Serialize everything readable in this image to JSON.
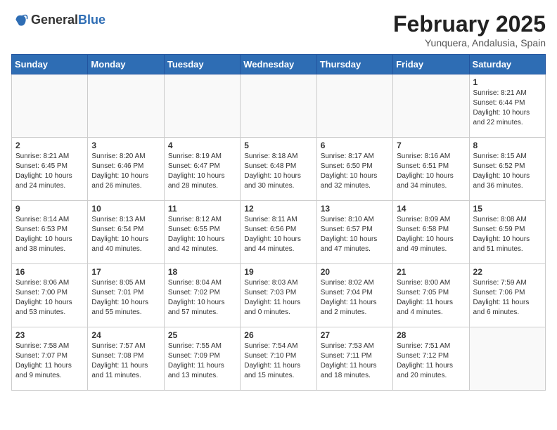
{
  "header": {
    "logo_general": "General",
    "logo_blue": "Blue",
    "month_title": "February 2025",
    "location": "Yunquera, Andalusia, Spain"
  },
  "weekdays": [
    "Sunday",
    "Monday",
    "Tuesday",
    "Wednesday",
    "Thursday",
    "Friday",
    "Saturday"
  ],
  "weeks": [
    [
      {
        "day": "",
        "info": ""
      },
      {
        "day": "",
        "info": ""
      },
      {
        "day": "",
        "info": ""
      },
      {
        "day": "",
        "info": ""
      },
      {
        "day": "",
        "info": ""
      },
      {
        "day": "",
        "info": ""
      },
      {
        "day": "1",
        "info": "Sunrise: 8:21 AM\nSunset: 6:44 PM\nDaylight: 10 hours and 22 minutes."
      }
    ],
    [
      {
        "day": "2",
        "info": "Sunrise: 8:21 AM\nSunset: 6:45 PM\nDaylight: 10 hours and 24 minutes."
      },
      {
        "day": "3",
        "info": "Sunrise: 8:20 AM\nSunset: 6:46 PM\nDaylight: 10 hours and 26 minutes."
      },
      {
        "day": "4",
        "info": "Sunrise: 8:19 AM\nSunset: 6:47 PM\nDaylight: 10 hours and 28 minutes."
      },
      {
        "day": "5",
        "info": "Sunrise: 8:18 AM\nSunset: 6:48 PM\nDaylight: 10 hours and 30 minutes."
      },
      {
        "day": "6",
        "info": "Sunrise: 8:17 AM\nSunset: 6:50 PM\nDaylight: 10 hours and 32 minutes."
      },
      {
        "day": "7",
        "info": "Sunrise: 8:16 AM\nSunset: 6:51 PM\nDaylight: 10 hours and 34 minutes."
      },
      {
        "day": "8",
        "info": "Sunrise: 8:15 AM\nSunset: 6:52 PM\nDaylight: 10 hours and 36 minutes."
      }
    ],
    [
      {
        "day": "9",
        "info": "Sunrise: 8:14 AM\nSunset: 6:53 PM\nDaylight: 10 hours and 38 minutes."
      },
      {
        "day": "10",
        "info": "Sunrise: 8:13 AM\nSunset: 6:54 PM\nDaylight: 10 hours and 40 minutes."
      },
      {
        "day": "11",
        "info": "Sunrise: 8:12 AM\nSunset: 6:55 PM\nDaylight: 10 hours and 42 minutes."
      },
      {
        "day": "12",
        "info": "Sunrise: 8:11 AM\nSunset: 6:56 PM\nDaylight: 10 hours and 44 minutes."
      },
      {
        "day": "13",
        "info": "Sunrise: 8:10 AM\nSunset: 6:57 PM\nDaylight: 10 hours and 47 minutes."
      },
      {
        "day": "14",
        "info": "Sunrise: 8:09 AM\nSunset: 6:58 PM\nDaylight: 10 hours and 49 minutes."
      },
      {
        "day": "15",
        "info": "Sunrise: 8:08 AM\nSunset: 6:59 PM\nDaylight: 10 hours and 51 minutes."
      }
    ],
    [
      {
        "day": "16",
        "info": "Sunrise: 8:06 AM\nSunset: 7:00 PM\nDaylight: 10 hours and 53 minutes."
      },
      {
        "day": "17",
        "info": "Sunrise: 8:05 AM\nSunset: 7:01 PM\nDaylight: 10 hours and 55 minutes."
      },
      {
        "day": "18",
        "info": "Sunrise: 8:04 AM\nSunset: 7:02 PM\nDaylight: 10 hours and 57 minutes."
      },
      {
        "day": "19",
        "info": "Sunrise: 8:03 AM\nSunset: 7:03 PM\nDaylight: 11 hours and 0 minutes."
      },
      {
        "day": "20",
        "info": "Sunrise: 8:02 AM\nSunset: 7:04 PM\nDaylight: 11 hours and 2 minutes."
      },
      {
        "day": "21",
        "info": "Sunrise: 8:00 AM\nSunset: 7:05 PM\nDaylight: 11 hours and 4 minutes."
      },
      {
        "day": "22",
        "info": "Sunrise: 7:59 AM\nSunset: 7:06 PM\nDaylight: 11 hours and 6 minutes."
      }
    ],
    [
      {
        "day": "23",
        "info": "Sunrise: 7:58 AM\nSunset: 7:07 PM\nDaylight: 11 hours and 9 minutes."
      },
      {
        "day": "24",
        "info": "Sunrise: 7:57 AM\nSunset: 7:08 PM\nDaylight: 11 hours and 11 minutes."
      },
      {
        "day": "25",
        "info": "Sunrise: 7:55 AM\nSunset: 7:09 PM\nDaylight: 11 hours and 13 minutes."
      },
      {
        "day": "26",
        "info": "Sunrise: 7:54 AM\nSunset: 7:10 PM\nDaylight: 11 hours and 15 minutes."
      },
      {
        "day": "27",
        "info": "Sunrise: 7:53 AM\nSunset: 7:11 PM\nDaylight: 11 hours and 18 minutes."
      },
      {
        "day": "28",
        "info": "Sunrise: 7:51 AM\nSunset: 7:12 PM\nDaylight: 11 hours and 20 minutes."
      },
      {
        "day": "",
        "info": ""
      }
    ]
  ]
}
